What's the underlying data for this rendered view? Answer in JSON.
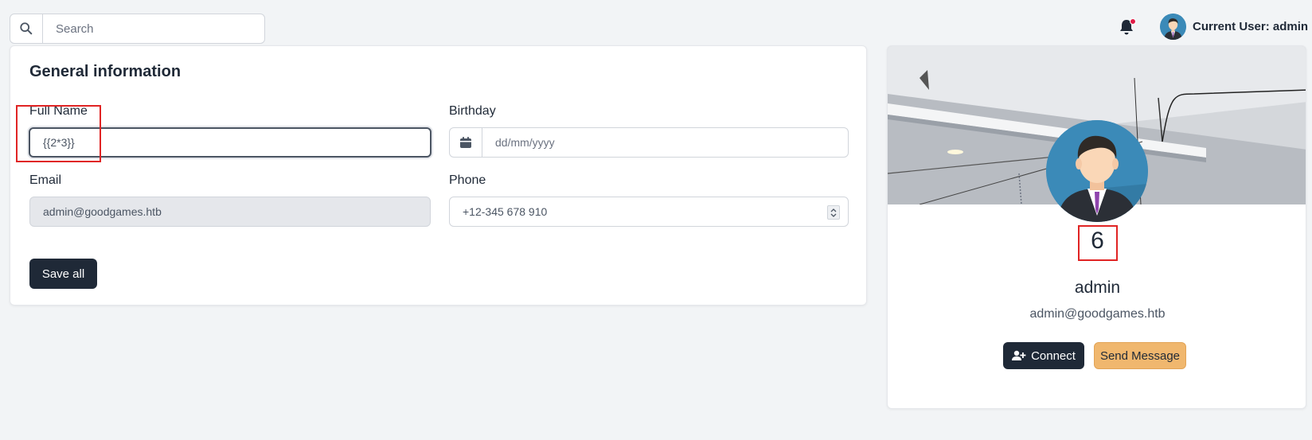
{
  "topbar": {
    "search_placeholder": "Search",
    "user_label": "Current User: admin",
    "notification_dot_color": "#e11d48"
  },
  "form": {
    "title": "General information",
    "full_name_label": "Full Name",
    "full_name_value": "{{2*3}}",
    "birthday_label": "Birthday",
    "birthday_placeholder": "dd/mm/yyyy",
    "email_label": "Email",
    "email_value": "admin@goodgames.htb",
    "phone_label": "Phone",
    "phone_value": "+12-345 678 910",
    "save_label": "Save all"
  },
  "profile": {
    "rendered_name": "6",
    "username": "admin",
    "email": "admin@goodgames.htb",
    "connect_label": "Connect",
    "message_label": "Send Message"
  },
  "colors": {
    "primary_dark": "#1f2937",
    "warning": "#f0b76e",
    "highlight_box": "#e02424"
  }
}
